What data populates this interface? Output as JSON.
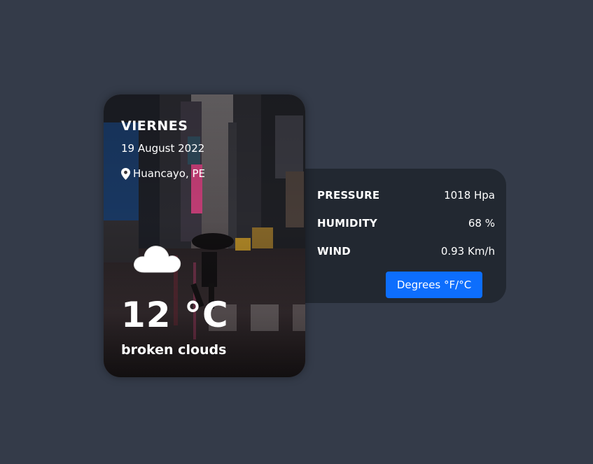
{
  "card": {
    "day": "VIERNES",
    "date": "19 August 2022",
    "location": "Huancayo, PE",
    "temperature": "12 °C",
    "description": "broken clouds",
    "weather_icon": "cloud-icon",
    "location_icon": "map-pin-icon"
  },
  "details": [
    {
      "label": "PRESSURE",
      "value": "1018 Hpa"
    },
    {
      "label": "HUMIDITY",
      "value": "68 %"
    },
    {
      "label": "WIND",
      "value": "0.93 Km/h"
    }
  ],
  "unit_button": {
    "label": "Degrees °F/°C",
    "color": "#0d6efd"
  },
  "colors": {
    "background": "#343b49",
    "panel": "#222831"
  }
}
